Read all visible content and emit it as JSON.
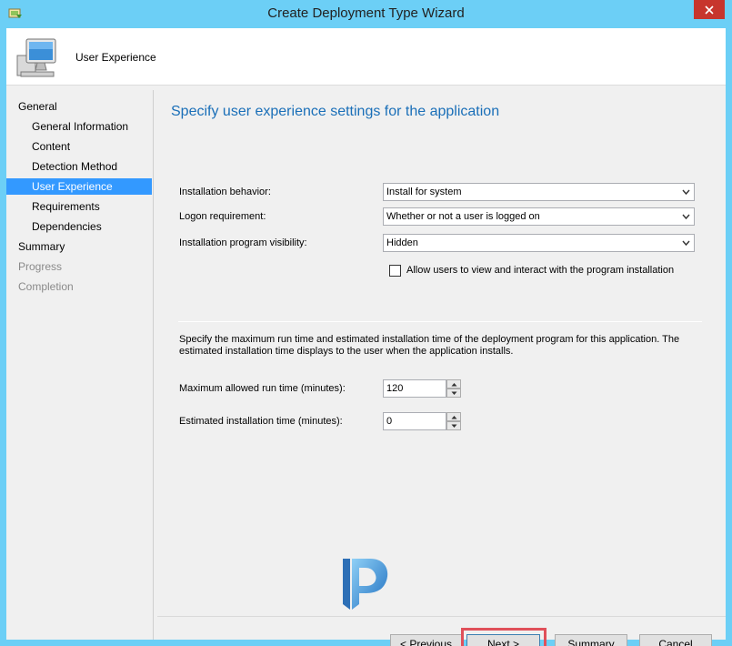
{
  "window": {
    "title": "Create Deployment Type Wizard"
  },
  "header": {
    "title": "User Experience"
  },
  "nav": {
    "items": [
      {
        "label": "General",
        "level": "top",
        "state": "normal"
      },
      {
        "label": "General Information",
        "level": "sub",
        "state": "normal"
      },
      {
        "label": "Content",
        "level": "sub",
        "state": "normal"
      },
      {
        "label": "Detection Method",
        "level": "sub",
        "state": "normal"
      },
      {
        "label": "User Experience",
        "level": "sub",
        "state": "selected"
      },
      {
        "label": "Requirements",
        "level": "sub",
        "state": "normal"
      },
      {
        "label": "Dependencies",
        "level": "sub",
        "state": "normal"
      },
      {
        "label": "Summary",
        "level": "top",
        "state": "normal"
      },
      {
        "label": "Progress",
        "level": "top",
        "state": "disabled"
      },
      {
        "label": "Completion",
        "level": "top",
        "state": "disabled"
      }
    ]
  },
  "main": {
    "title": "Specify user experience settings for the application",
    "installation_behavior": {
      "label": "Installation behavior:",
      "value": "Install for system"
    },
    "logon_requirement": {
      "label": "Logon requirement:",
      "value": "Whether or not a user is logged on"
    },
    "program_visibility": {
      "label": "Installation program visibility:",
      "value": "Hidden"
    },
    "allow_interact": {
      "label": "Allow users to view and interact with the program installation",
      "checked": false
    },
    "description": "Specify the maximum run time and estimated installation time of the deployment program for this application. The estimated installation time displays to the user when the application installs.",
    "max_run_time": {
      "label": "Maximum allowed run time (minutes):",
      "value": "120"
    },
    "est_install_time": {
      "label": "Estimated installation time (minutes):",
      "value": "0"
    }
  },
  "buttons": {
    "previous": "< Previous",
    "next": "Next >",
    "summary": "Summary",
    "cancel": "Cancel"
  },
  "colors": {
    "titlebar": "#6ccff6",
    "accent_title": "#1a6fb8",
    "nav_selected": "#3399ff",
    "close_button": "#c7352d",
    "next_highlight": "#e0505a"
  },
  "icons": {
    "window": "wizard-app-icon",
    "header": "computer-monitor-icon",
    "watermark": "p-logo-icon"
  }
}
